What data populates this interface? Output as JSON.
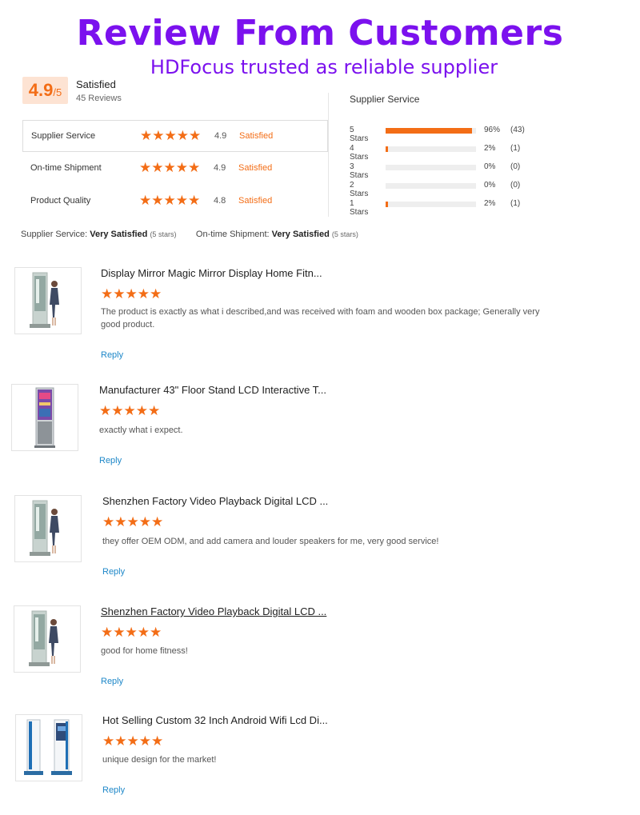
{
  "header": {
    "title": "Review From Customers",
    "subtitle": "HDFocus trusted as reliable supplier"
  },
  "rating": {
    "score": "4.9",
    "out_of": "/5",
    "label": "Satisfied",
    "reviews_count": "45 Reviews"
  },
  "categories": [
    {
      "name": "Supplier Service",
      "score": "4.9",
      "label": "Satisfied",
      "stars": 5
    },
    {
      "name": "On-time Shipment",
      "score": "4.9",
      "label": "Satisfied",
      "stars": 5
    },
    {
      "name": "Product Quality",
      "score": "4.8",
      "label": "Satisfied",
      "stars": 5
    }
  ],
  "breakdown": {
    "title": "Supplier Service",
    "rows": [
      {
        "label": "5 Stars",
        "percent": "96%",
        "count": "(43)",
        "fill": 0.96
      },
      {
        "label": "4 Stars",
        "percent": "2%",
        "count": "(1)",
        "fill": 0.02
      },
      {
        "label": "3 Stars",
        "percent": "0%",
        "count": "(0)",
        "fill": 0
      },
      {
        "label": "2 Stars",
        "percent": "0%",
        "count": "(0)",
        "fill": 0
      },
      {
        "label": "1 Stars",
        "percent": "2%",
        "count": "(1)",
        "fill": 0.02
      }
    ]
  },
  "summary": {
    "supplier_label": "Supplier Service:",
    "supplier_value": "Very Satisfied",
    "supplier_note": "(5 stars)",
    "shipment_label": "On-time Shipment:",
    "shipment_value": "Very Satisfied",
    "shipment_note": "(5 stars)"
  },
  "reviews": [
    {
      "title": "Display Mirror Magic Mirror Display Home Fitn...",
      "stars": 5,
      "body": "The product is exactly as what i described,and was received with foam and wooden box package; Generally very good product.",
      "reply": "Reply",
      "image": "mirror-display-person"
    },
    {
      "title": "Manufacturer 43\" Floor Stand LCD Interactive T...",
      "stars": 5,
      "body": "exactly what i expect.",
      "reply": "Reply",
      "image": "floor-stand-lcd"
    },
    {
      "title": "Shenzhen Factory Video Playback Digital LCD ...",
      "stars": 5,
      "body": "they offer OEM ODM, and add camera and louder speakers for me, very good service!",
      "reply": "Reply",
      "image": "mirror-display-person"
    },
    {
      "title": "Shenzhen Factory Video Playback Digital LCD ...",
      "stars": 5,
      "body": "good for home fitness!",
      "reply": "Reply",
      "image": "mirror-display-person"
    },
    {
      "title": "Hot Selling Custom 32 Inch Android Wifi Lcd Di...",
      "stars": 5,
      "body": "unique design for the market!",
      "reply": "Reply",
      "image": "android-kiosk-pair"
    }
  ],
  "colors": {
    "title": "#7b11ee",
    "accent": "#f36d16",
    "link": "#1d87c8",
    "score_bg": "#fde3d3"
  }
}
